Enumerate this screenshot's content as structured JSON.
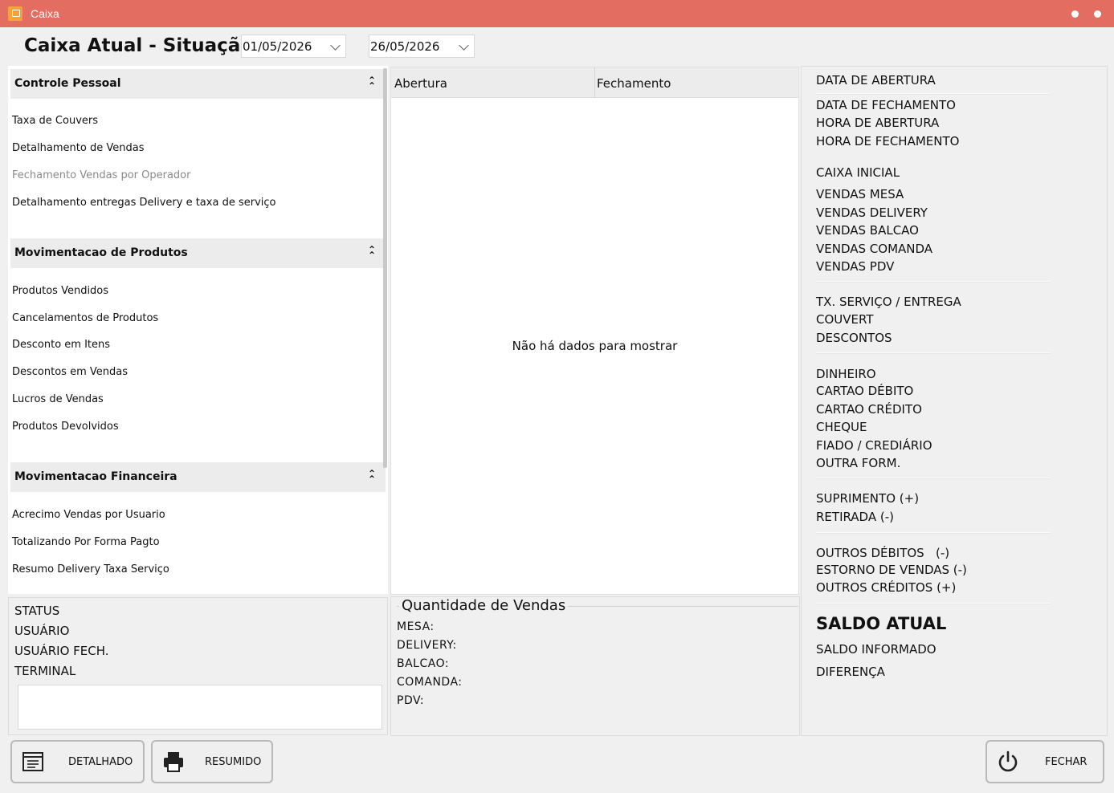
{
  "window": {
    "title": "Caixa"
  },
  "header": {
    "title": "Caixa Atual - Situação",
    "date_from": "01/05/2026",
    "date_to": "26/05/2026"
  },
  "reports": {
    "groups": [
      {
        "title": "Controle Pessoal",
        "items": [
          "Taxa de Couvers",
          "Detalhamento de Vendas",
          "Fechamento Vendas por Operador",
          "Detalhamento entregas Delivery e taxa de serviço"
        ]
      },
      {
        "title": "Movimentacao de Produtos",
        "items": [
          "Produtos Vendidos",
          "Cancelamentos de Produtos",
          "Desconto em Itens",
          "Descontos em Vendas",
          "Lucros de Vendas",
          "Produtos Devolvidos"
        ]
      },
      {
        "title": "Movimentacao Financeira",
        "items": [
          "Acrecimo Vendas por Usuario",
          "Totalizando Por Forma Pagto",
          "Resumo Delivery Taxa Serviço"
        ]
      }
    ]
  },
  "status": {
    "labels": [
      "STATUS",
      "USUÁRIO",
      "USUÁRIO FECH.",
      "TERMINAL"
    ]
  },
  "grid": {
    "columns": [
      "Abertura",
      "Fechamento"
    ],
    "empty_message": "Não há dados para mostrar"
  },
  "quantity": {
    "title": "Quantidade de Vendas",
    "labels": [
      "MESA:",
      "DELIVERY:",
      "BALCAO:",
      "COMANDA:",
      "PDV:"
    ]
  },
  "summary": {
    "items": [
      "DATA DE ABERTURA",
      "DATA DE FECHAMENTO",
      "HORA DE ABERTURA",
      "HORA DE FECHAMENTO",
      "CAIXA INICIAL",
      "VENDAS MESA",
      "VENDAS DELIVERY",
      "VENDAS BALCAO",
      "VENDAS COMANDA",
      "VENDAS PDV",
      "TX. SERVIÇO / ENTREGA",
      "COUVERT",
      "DESCONTOS",
      "DINHEIRO",
      "CARTAO DÉBITO",
      "CARTAO CRÉDITO",
      "CHEQUE",
      "FIADO / CREDIÁRIO",
      "OUTRA FORM.",
      "SUPRIMENTO (+)",
      "RETIRADA (-)",
      "OUTROS DÉBITOS   (-)",
      "ESTORNO DE VENDAS (-)",
      "OUTROS CRÉDITOS (+)"
    ],
    "balance_title": "SALDO ATUAL",
    "informed": "SALDO INFORMADO",
    "difference": "DIFERENÇA"
  },
  "buttons": {
    "detailed": "DETALHADO",
    "summary": "RESUMIDO",
    "close": "FECHAR"
  },
  "colors": {
    "titlebar": "#e46d62",
    "app_icon": "#f6a23a"
  },
  "icons": [
    "app-icon",
    "collapse-icon",
    "chevron-down-icon",
    "report-icon",
    "printer-icon",
    "power-icon"
  ]
}
